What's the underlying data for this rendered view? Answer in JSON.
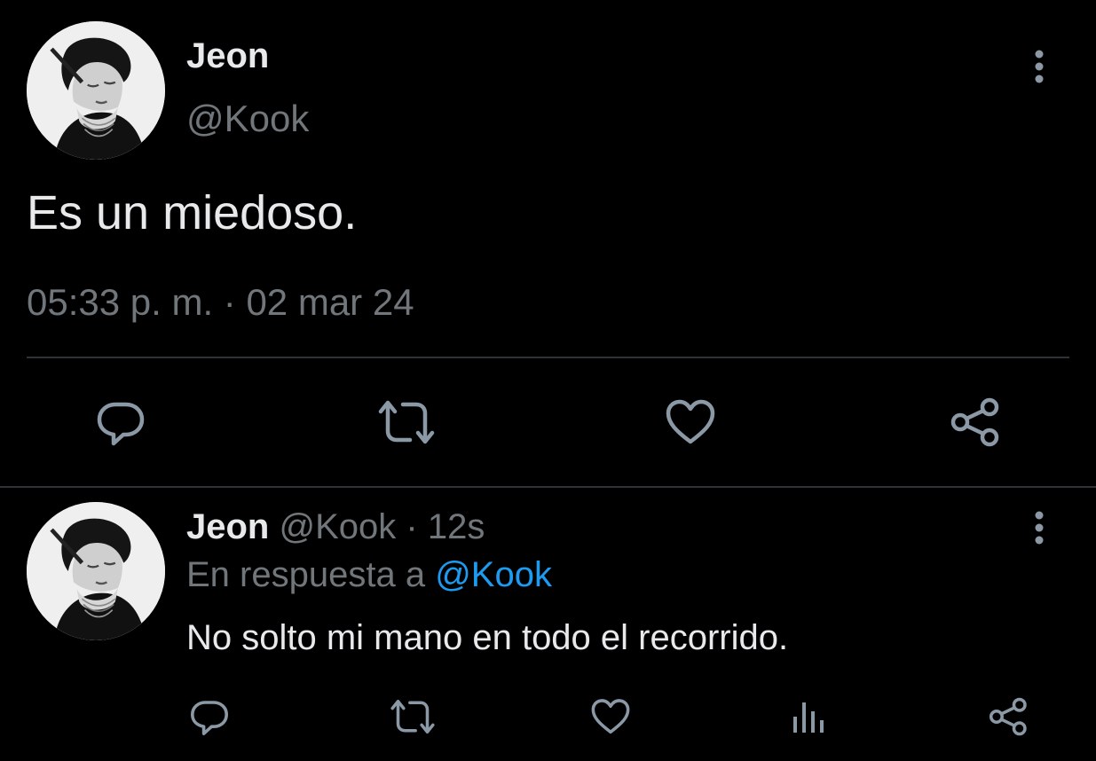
{
  "colors": {
    "background": "#000000",
    "text_primary": "#e7e9ea",
    "text_muted": "#71767b",
    "link": "#1d9bf0",
    "divider": "#2f3336"
  },
  "main_tweet": {
    "display_name": "Jeon",
    "handle": "@Kook",
    "text": "Es un miedoso.",
    "timestamp": "05:33 p. m. · 02 mar 24",
    "avatar_icon": "profile-portrait",
    "more_icon": "more-vertical-icon",
    "actions": [
      {
        "name": "reply",
        "icon": "reply-bubble-icon"
      },
      {
        "name": "retweet",
        "icon": "retweet-icon"
      },
      {
        "name": "like",
        "icon": "heart-icon"
      },
      {
        "name": "share",
        "icon": "share-nodes-icon"
      }
    ]
  },
  "reply_tweet": {
    "display_name": "Jeon",
    "handle": "@Kook",
    "separator": "·",
    "time_ago": "12s",
    "reply_prefix": "En respuesta a",
    "reply_to": "@Kook",
    "text": "No solto mi mano en todo el recorrido.",
    "avatar_icon": "profile-portrait",
    "more_icon": "more-vertical-icon",
    "actions": [
      {
        "name": "reply",
        "icon": "reply-bubble-icon"
      },
      {
        "name": "retweet",
        "icon": "retweet-icon"
      },
      {
        "name": "like",
        "icon": "heart-icon"
      },
      {
        "name": "views",
        "icon": "analytics-bars-icon"
      },
      {
        "name": "share",
        "icon": "share-nodes-icon"
      }
    ]
  }
}
